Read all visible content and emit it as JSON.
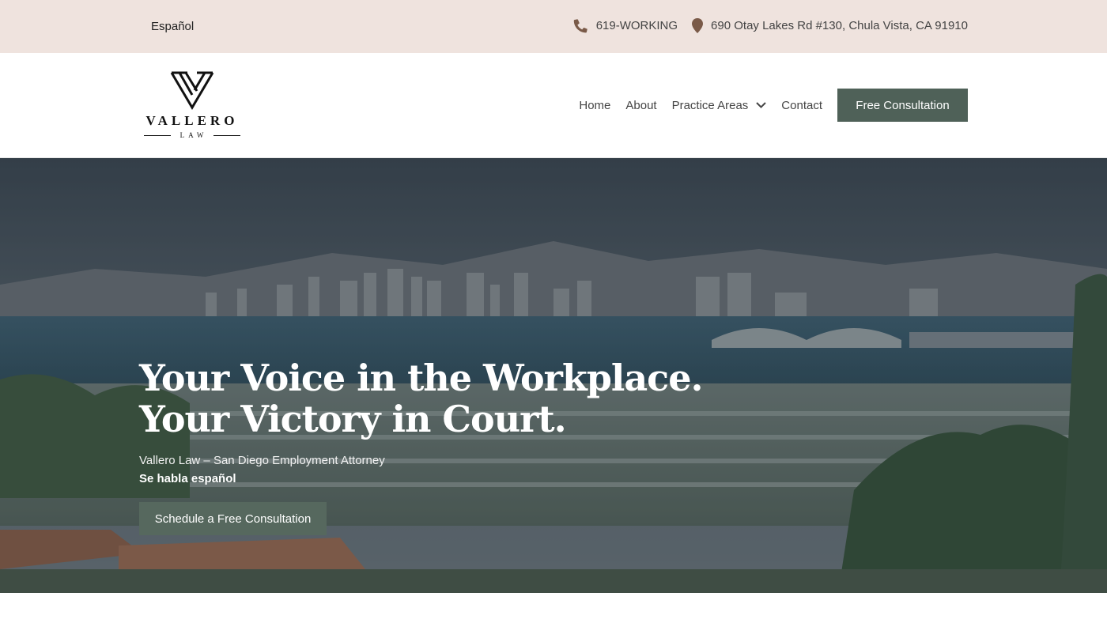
{
  "topbar": {
    "language_link": "Español",
    "phone": "619-WORKING",
    "address": "690 Otay Lakes Rd #130, Chula Vista, CA 91910",
    "phone_icon": "phone-icon",
    "address_icon": "map-pin-icon"
  },
  "logo": {
    "name": "VALLERO",
    "sub": "LAW"
  },
  "nav": {
    "items": [
      {
        "label": "Home"
      },
      {
        "label": "About"
      },
      {
        "label": "Practice Areas",
        "icon": "chevron-down-icon"
      },
      {
        "label": "Contact"
      }
    ],
    "cta_label": "Free Consultation"
  },
  "hero": {
    "title_line1": "Your Voice in the Workplace.",
    "title_line2": "Your Victory in Court.",
    "subtitle": "Vallero Law – San Diego Employment Attorney",
    "subtitle2": "Se habla español",
    "button_label": "Schedule a Free Consultation"
  },
  "colors": {
    "topbar_bg": "#efe3de",
    "accent_green": "#4f6158",
    "icon_brown": "#7a5a48"
  }
}
